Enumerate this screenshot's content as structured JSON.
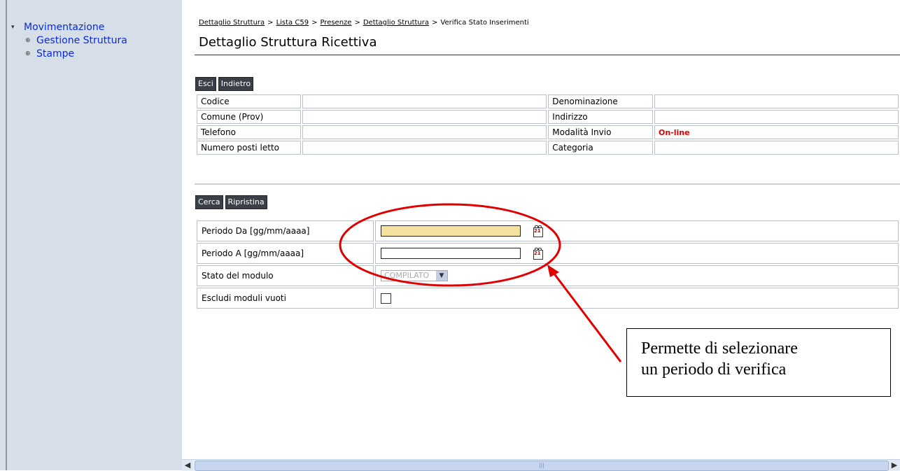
{
  "sidebar": {
    "root_label": "Movimentazione",
    "items": [
      {
        "label": "Gestione Struttura"
      },
      {
        "label": "Stampe"
      }
    ]
  },
  "breadcrumb": {
    "items": [
      "Dettaglio Struttura",
      "Lista C59",
      "Presenze",
      "Dettaglio Struttura"
    ],
    "current": "Verifica Stato Inserimenti",
    "separator": ">"
  },
  "page_title": "Dettaglio Struttura Ricettiva",
  "buttons_top": {
    "exit": "Esci",
    "back": "Indietro"
  },
  "detail": {
    "codice_label": "Codice",
    "codice_value": "",
    "denominazione_label": "Denominazione",
    "denominazione_value": "",
    "comune_label": "Comune (Prov)",
    "comune_value": "",
    "indirizzo_label": "Indirizzo",
    "indirizzo_value": "",
    "telefono_label": "Telefono",
    "telefono_value": "",
    "modalita_label": "Modalità Invio",
    "modalita_value": "On-line",
    "posti_label": "Numero posti letto",
    "posti_value": "",
    "categoria_label": "Categoria",
    "categoria_value": ""
  },
  "buttons_search": {
    "search": "Cerca",
    "reset": "Ripristina"
  },
  "search": {
    "periodo_da_label": "Periodo Da [gg/mm/aaaa]",
    "periodo_da_value": "",
    "periodo_a_label": "Periodo A [gg/mm/aaaa]",
    "periodo_a_value": "",
    "stato_label": "Stato del modulo",
    "stato_value": "COMPILATO",
    "escludi_label": "Escludi moduli vuoti"
  },
  "calendar_icon_text": "21",
  "annotation": {
    "line1": "Permette di selezionare",
    "line2": "un periodo di verifica"
  },
  "colors": {
    "sidebar_bg": "#d6dee8",
    "link": "#0a2bdd",
    "date_highlight": "#f5e29e",
    "annotation_red": "#e00000",
    "online_red": "#e00000"
  }
}
